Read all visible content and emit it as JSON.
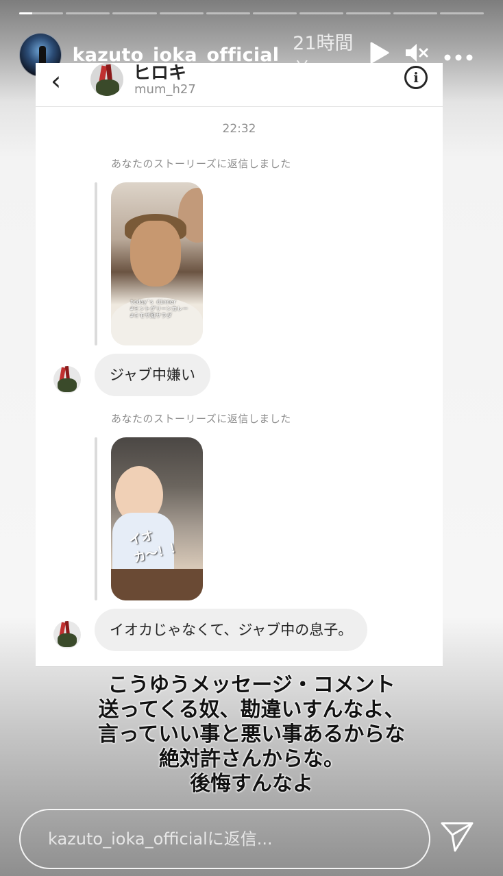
{
  "story": {
    "progress": [
      1,
      0,
      0,
      0,
      0,
      0,
      0,
      0,
      0,
      0
    ],
    "progress_current_fraction": 0.3,
    "username": "kazuto_ioka_official",
    "time_ago": "21時間前",
    "icons": {
      "play": "play-icon",
      "mute": "mute-icon",
      "more": "more-icon"
    }
  },
  "dm": {
    "back_icon": "‹",
    "contact_name": "ヒロキ",
    "contact_handle": "mum_h27",
    "info_icon": "i",
    "timestamp": "22:32",
    "messages": [
      {
        "reply_note": "あなたのストーリーズに返信しました",
        "story_caption": "today's dinner\n#ミントグリーンカレー\n#ミモザ風サラダ",
        "text": "ジャブ中嫌い"
      },
      {
        "reply_note": "あなたのストーリーズに返信しました",
        "sticker": "イオカ〜！！",
        "text": "イオカじゃなくて、ジャブ中の息子。"
      }
    ]
  },
  "caption": {
    "lines": [
      "こうゆうメッセージ・コメント",
      "送ってくる奴、勘違いすんなよ、",
      "言っていい事と悪い事あるからな",
      "絶対許さんからな。",
      "後悔すんなよ"
    ]
  },
  "reply": {
    "placeholder": "kazuto_ioka_officialに返信..."
  },
  "colors": {
    "bubble": "#efefef",
    "muted_text": "#8e8e8e",
    "text": "#262626"
  }
}
